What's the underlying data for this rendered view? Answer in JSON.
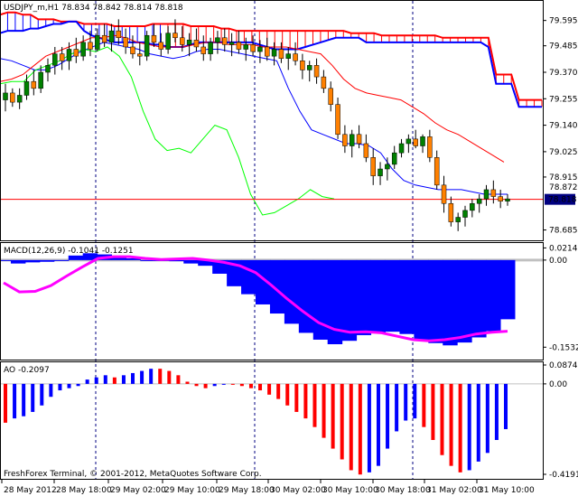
{
  "window": {
    "symbol_header": "USDJPY_m,H1  78.834 78.842 78.814 78.818",
    "copyright": "FreshForex Terminal, © 2001-2012, MetaQuotes Software Corp."
  },
  "price_panel": {
    "ticks": [
      "79.595",
      "79.485",
      "79.370",
      "79.255",
      "79.140",
      "79.025",
      "78.915",
      "78.685"
    ],
    "current_price_label": "78.818",
    "hidden_price_label": "78.872"
  },
  "macd_panel": {
    "label": "MACD(12,26,9) -0.1041 -0.1251",
    "ticks": [
      "0.0214",
      "0.00",
      "-0.1532"
    ]
  },
  "ao_panel": {
    "label": "AO -0.2097",
    "ticks": [
      "0.0874",
      "0.00",
      "-0.4191"
    ]
  },
  "time_axis": {
    "labels": [
      "28 May 2012",
      "28 May 18:00",
      "29 May 02:00",
      "29 May 10:00",
      "29 May 18:00",
      "30 May 02:00",
      "30 May 10:00",
      "30 May 18:00",
      "31 May 02:00",
      "31 May 10:00"
    ]
  },
  "colors": {
    "background": "#ffffff",
    "grid": "#000080",
    "bull": "#008000",
    "bear": "#ff8000",
    "cloud_up": "#0000ff",
    "cloud_down": "#ff0000",
    "tenkan": "#ff0000",
    "kijun": "#0000ff",
    "chikou": "#00ff00",
    "macd_hist": "#0000ff",
    "macd_signal": "#ff00ff",
    "ao_up": "#0000ff",
    "ao_down": "#ff0000",
    "price_line": "#ff0000",
    "zero_line": "#c0c0c0"
  },
  "chart_data": [
    {
      "type": "candlestick",
      "title": "USDJPY_m,H1",
      "ylim": [
        78.64,
        79.68
      ],
      "candles": [
        [
          79.25,
          79.32,
          79.2,
          79.28
        ],
        [
          79.28,
          79.3,
          79.22,
          79.24
        ],
        [
          79.24,
          79.3,
          79.21,
          79.27
        ],
        [
          79.27,
          79.36,
          79.25,
          79.33
        ],
        [
          79.33,
          79.38,
          79.27,
          79.3
        ],
        [
          79.3,
          79.4,
          79.28,
          79.37
        ],
        [
          79.37,
          79.43,
          79.33,
          79.4
        ],
        [
          79.4,
          79.48,
          79.36,
          79.45
        ],
        [
          79.45,
          79.48,
          79.38,
          79.42
        ],
        [
          79.42,
          79.5,
          79.38,
          79.47
        ],
        [
          79.47,
          79.52,
          79.41,
          79.44
        ],
        [
          79.44,
          79.53,
          79.42,
          79.5
        ],
        [
          79.5,
          79.55,
          79.44,
          79.47
        ],
        [
          79.47,
          79.56,
          79.46,
          79.53
        ],
        [
          79.53,
          79.58,
          79.48,
          79.5
        ],
        [
          79.5,
          79.58,
          79.46,
          79.55
        ],
        [
          79.55,
          79.6,
          79.49,
          79.52
        ],
        [
          79.52,
          79.56,
          79.45,
          79.48
        ],
        [
          79.48,
          79.53,
          79.43,
          79.45
        ],
        [
          79.45,
          79.5,
          79.4,
          79.44
        ],
        [
          79.44,
          79.55,
          79.42,
          79.53
        ],
        [
          79.53,
          79.58,
          79.48,
          79.5
        ],
        [
          79.5,
          79.54,
          79.44,
          79.47
        ],
        [
          79.47,
          79.57,
          79.45,
          79.54
        ],
        [
          79.54,
          79.6,
          79.5,
          79.52
        ],
        [
          79.52,
          79.57,
          79.46,
          79.49
        ],
        [
          79.49,
          79.54,
          79.44,
          79.51
        ],
        [
          79.51,
          79.56,
          79.46,
          79.48
        ],
        [
          79.48,
          79.53,
          79.42,
          79.45
        ],
        [
          79.45,
          79.52,
          79.42,
          79.5
        ],
        [
          79.5,
          79.55,
          79.45,
          79.52
        ],
        [
          79.52,
          79.56,
          79.46,
          79.49
        ],
        [
          79.49,
          79.54,
          79.44,
          79.5
        ],
        [
          79.5,
          79.55,
          79.45,
          79.47
        ],
        [
          79.47,
          79.52,
          79.42,
          79.49
        ],
        [
          79.49,
          79.53,
          79.44,
          79.46
        ],
        [
          79.46,
          79.51,
          79.41,
          79.48
        ],
        [
          79.48,
          79.52,
          79.42,
          79.44
        ],
        [
          79.44,
          79.5,
          79.4,
          79.47
        ],
        [
          79.47,
          79.5,
          79.41,
          79.43
        ],
        [
          79.43,
          79.48,
          79.38,
          79.45
        ],
        [
          79.45,
          79.5,
          79.4,
          79.42
        ],
        [
          79.42,
          79.45,
          79.34,
          79.38
        ],
        [
          79.38,
          79.42,
          79.33,
          79.4
        ],
        [
          79.4,
          79.43,
          79.32,
          79.35
        ],
        [
          79.35,
          79.38,
          79.28,
          79.3
        ],
        [
          79.3,
          79.33,
          79.2,
          79.23
        ],
        [
          79.23,
          79.26,
          79.08,
          79.1
        ],
        [
          79.1,
          79.14,
          79.02,
          79.05
        ],
        [
          79.05,
          79.12,
          79.0,
          79.1
        ],
        [
          79.1,
          79.14,
          79.04,
          79.06
        ],
        [
          79.06,
          79.1,
          78.98,
          79.0
        ],
        [
          79.0,
          79.04,
          78.88,
          78.92
        ],
        [
          78.92,
          78.98,
          78.88,
          78.95
        ],
        [
          78.95,
          79.0,
          78.9,
          78.97
        ],
        [
          78.97,
          79.05,
          78.95,
          79.02
        ],
        [
          79.02,
          79.08,
          79.0,
          79.06
        ],
        [
          79.06,
          79.1,
          79.02,
          79.08
        ],
        [
          79.08,
          79.12,
          79.04,
          79.05
        ],
        [
          79.05,
          79.1,
          79.02,
          79.09
        ],
        [
          79.09,
          79.12,
          78.98,
          79.0
        ],
        [
          79.0,
          79.03,
          78.86,
          78.88
        ],
        [
          78.88,
          78.92,
          78.76,
          78.8
        ],
        [
          78.8,
          78.83,
          78.7,
          78.72
        ],
        [
          78.72,
          78.76,
          78.68,
          78.74
        ],
        [
          78.74,
          78.79,
          78.7,
          78.77
        ],
        [
          78.77,
          78.82,
          78.74,
          78.8
        ],
        [
          78.8,
          78.84,
          78.76,
          78.82
        ],
        [
          78.82,
          78.88,
          78.79,
          78.86
        ],
        [
          78.86,
          78.9,
          78.8,
          78.83
        ],
        [
          78.83,
          78.86,
          78.78,
          78.81
        ],
        [
          78.81,
          78.84,
          78.79,
          78.82
        ]
      ],
      "current_price": 78.818
    },
    {
      "type": "bar",
      "title": "MACD(12,26,9)",
      "ylim": [
        -0.175,
        0.03
      ],
      "values": [
        0.0,
        -0.006,
        -0.004,
        -0.003,
        0.0,
        0.008,
        0.012,
        0.01,
        0.006,
        0.003,
        0.0,
        0.0,
        -0.002,
        -0.006,
        -0.01,
        -0.024,
        -0.046,
        -0.06,
        -0.078,
        -0.094,
        -0.112,
        -0.128,
        -0.14,
        -0.148,
        -0.142,
        -0.132,
        -0.128,
        -0.126,
        -0.13,
        -0.14,
        -0.146,
        -0.15,
        -0.145,
        -0.136,
        -0.125,
        -0.1041
      ],
      "signal": [
        -0.04,
        -0.056,
        -0.055,
        -0.045,
        -0.028,
        -0.012,
        0.003,
        0.006,
        0.006,
        0.003,
        0.001,
        0.002,
        0.003,
        0.0,
        -0.004,
        -0.01,
        -0.022,
        -0.044,
        -0.068,
        -0.09,
        -0.11,
        -0.122,
        -0.127,
        -0.126,
        -0.128,
        -0.134,
        -0.14,
        -0.142,
        -0.14,
        -0.136,
        -0.13,
        -0.127,
        -0.1251
      ]
    },
    {
      "type": "bar",
      "title": "AO",
      "ylim": [
        -0.44,
        0.1
      ],
      "values": [
        -0.18,
        -0.16,
        -0.15,
        -0.13,
        -0.1,
        -0.06,
        -0.03,
        -0.02,
        -0.01,
        0.02,
        0.03,
        0.04,
        0.03,
        0.04,
        0.05,
        0.06,
        0.07,
        0.07,
        0.06,
        0.04,
        0.01,
        -0.01,
        -0.02,
        -0.01,
        0.0,
        0.0,
        -0.01,
        -0.02,
        -0.03,
        -0.05,
        -0.07,
        -0.1,
        -0.13,
        -0.16,
        -0.2,
        -0.25,
        -0.3,
        -0.35,
        -0.4,
        -0.42,
        -0.41,
        -0.38,
        -0.3,
        -0.22,
        -0.17,
        -0.16,
        -0.2,
        -0.26,
        -0.33,
        -0.38,
        -0.41,
        -0.4,
        -0.36,
        -0.32,
        -0.26,
        -0.2097
      ]
    }
  ]
}
